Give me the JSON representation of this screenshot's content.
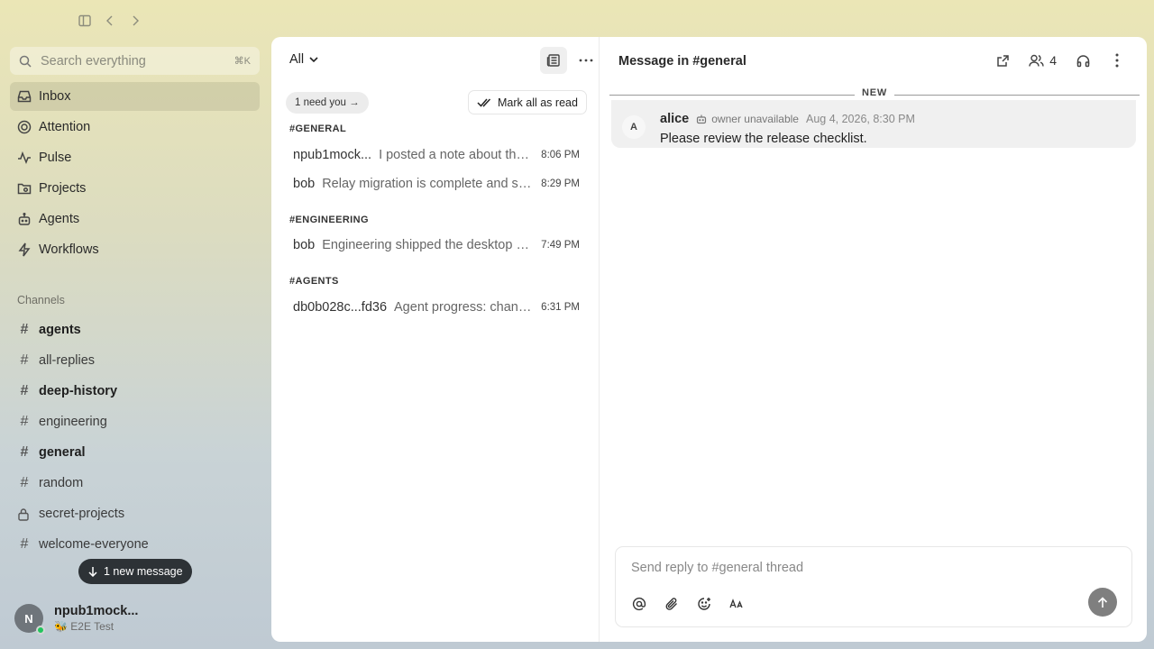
{
  "sidebar": {
    "search": {
      "placeholder": "Search everything",
      "shortcut": "⌘K"
    },
    "nav": [
      {
        "label": "Inbox",
        "icon": "inbox-icon",
        "active": true
      },
      {
        "label": "Attention",
        "icon": "target-icon"
      },
      {
        "label": "Pulse",
        "icon": "pulse-icon"
      },
      {
        "label": "Projects",
        "icon": "folder-icon"
      },
      {
        "label": "Agents",
        "icon": "bot-icon"
      },
      {
        "label": "Workflows",
        "icon": "bolt-icon"
      }
    ],
    "channels_heading": "Channels",
    "channels": [
      {
        "name": "agents",
        "unread": true,
        "icon": "hash-icon"
      },
      {
        "name": "all-replies",
        "unread": false,
        "icon": "hash-icon"
      },
      {
        "name": "deep-history",
        "unread": true,
        "icon": "hash-icon"
      },
      {
        "name": "engineering",
        "unread": false,
        "icon": "hash-icon"
      },
      {
        "name": "general",
        "unread": true,
        "icon": "hash-icon"
      },
      {
        "name": "random",
        "unread": false,
        "icon": "hash-icon"
      },
      {
        "name": "secret-projects",
        "unread": false,
        "icon": "lock-icon"
      },
      {
        "name": "welcome-everyone",
        "unread": false,
        "icon": "hash-icon"
      }
    ],
    "new_message_label": "1 new message",
    "user": {
      "initial": "N",
      "name": "npub1mock...",
      "status": "🐝 E2E Test",
      "online_color": "#22c55e"
    }
  },
  "inbox": {
    "filter_label": "All",
    "need_you_label": "1 need you →",
    "mark_all_label": "Mark all as read",
    "groups": [
      {
        "title": "#GENERAL",
        "items": [
          {
            "who": "npub1mock...",
            "preview": "I posted a note about the release checklist",
            "time": "8:06 PM"
          },
          {
            "who": "bob",
            "preview": "Relay migration is complete and stable",
            "time": "8:29 PM"
          }
        ]
      },
      {
        "title": "#ENGINEERING",
        "items": [
          {
            "who": "bob",
            "preview": "Engineering shipped the desktop build today",
            "time": "7:49 PM"
          }
        ]
      },
      {
        "title": "#AGENTS",
        "items": [
          {
            "who": "db0b028c...fd36",
            "preview": "Agent progress: channel sync complete",
            "time": "6:31 PM"
          }
        ]
      }
    ]
  },
  "thread": {
    "title": "Message in #general",
    "member_count": "4",
    "new_label": "NEW",
    "message": {
      "initial": "A",
      "author": "alice",
      "badge": "owner unavailable",
      "timestamp": "Aug 4, 2026, 8:30 PM",
      "body": "Please review the release checklist."
    },
    "composer_placeholder": "Send reply to #general thread"
  }
}
